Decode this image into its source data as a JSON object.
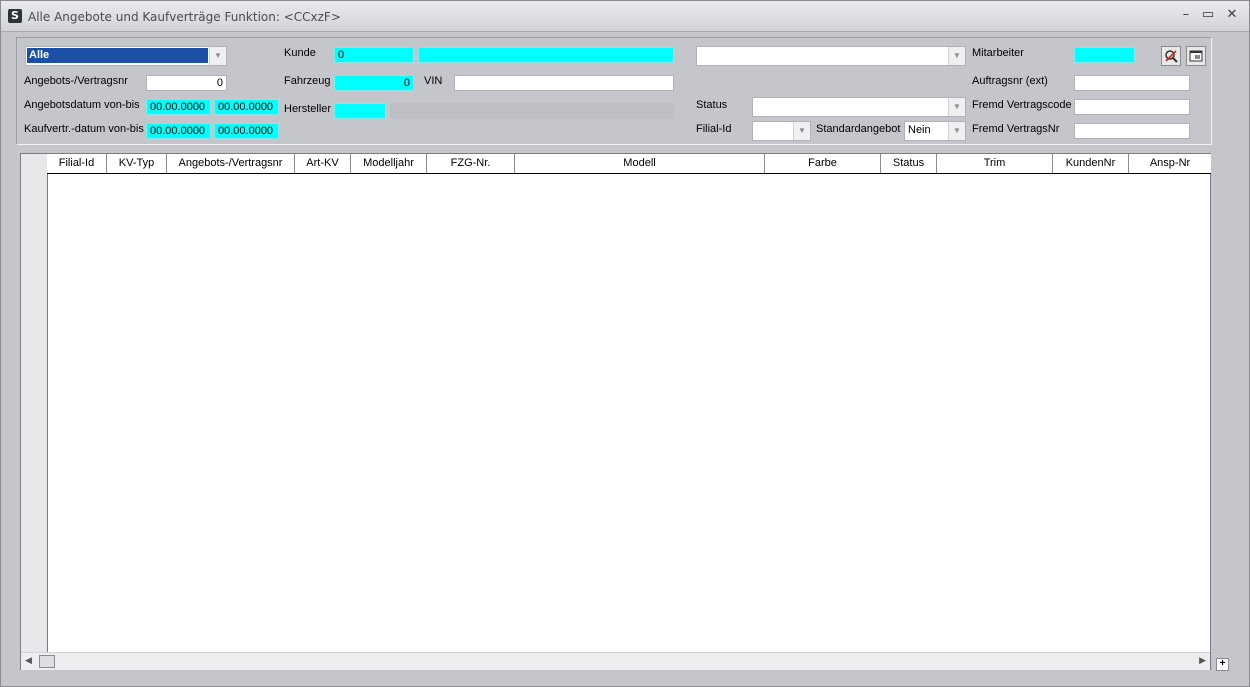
{
  "window": {
    "icon_glyph": "S",
    "title": "Alle Angebote und Kaufverträge   Funktion: <CCxzF>",
    "minimize": "–",
    "maximize": "▭",
    "close": "✕"
  },
  "filters": {
    "scope_select": "Alle",
    "angebots_nr_label": "Angebots-/Vertragsnr",
    "angebots_nr_value": "0",
    "angebotsdatum_label": "Angebotsdatum von-bis",
    "angebotsdatum_from": "00.00.0000",
    "angebotsdatum_to": "00.00.0000",
    "kaufvertr_label": "Kaufvertr.-datum von-bis",
    "kaufvertr_from": "00.00.0000",
    "kaufvertr_to": "00.00.0000",
    "kunde_label": "Kunde",
    "kunde_value": "0",
    "kunde_name": "",
    "fahrzeug_label": "Fahrzeug",
    "fahrzeug_value": "0",
    "vin_label": "VIN",
    "vin_value": "",
    "hersteller_label": "Hersteller",
    "hersteller_value": "",
    "top_combo_value": "",
    "status_label": "Status",
    "status_value": "",
    "filial_label": "Filial-Id",
    "filial_value": "",
    "standardangebot_label": "Standardangebot",
    "standardangebot_value": "Nein",
    "mitarbeiter_label": "Mitarbeiter",
    "mitarbeiter_value": "",
    "auftragsnr_label": "Auftragsnr (ext)",
    "auftragsnr_value": "",
    "fremd_code_label": "Fremd Vertragscode",
    "fremd_code_value": "",
    "fremd_nr_label": "Fremd VertragsNr",
    "fremd_nr_value": ""
  },
  "grid": {
    "columns": [
      "Filial-Id",
      "KV-Typ",
      "Angebots-/Vertragsnr",
      "Art-KV",
      "Modelljahr",
      "FZG-Nr.",
      "Modell",
      "Farbe",
      "Status",
      "Trim",
      "KundenNr",
      "Ansp-Nr"
    ],
    "rows": []
  },
  "icons": {
    "search_clear": "search-clear-icon",
    "form_view": "form-icon"
  },
  "colors": {
    "highlight_field": "#00ffff",
    "selection": "#1b4fa8"
  }
}
